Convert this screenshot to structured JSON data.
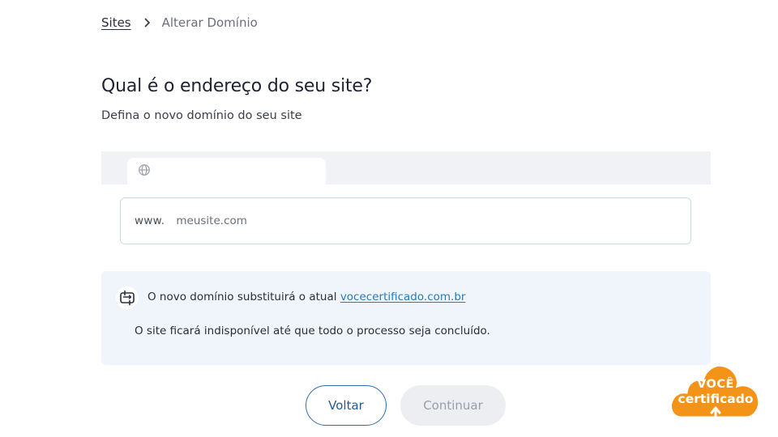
{
  "breadcrumb": {
    "parent": "Sites",
    "current": "Alterar Domínio",
    "separator_icon": "chevron-right-icon"
  },
  "header": {
    "title": "Qual é o endereço do seu site?",
    "subtitle": "Defina o novo domínio do seu site"
  },
  "tab": {
    "icon": "globe-icon",
    "label": ""
  },
  "domain_field": {
    "prefix": "www.",
    "placeholder": "meusite.com",
    "value": ""
  },
  "notice": {
    "icon": "swap-icon",
    "text_prefix": "O novo domínio substituirá o atual ",
    "current_domain": "vocecertificado.com.br",
    "warning": "O site ficará indisponível até que todo o processo seja concluído."
  },
  "actions": {
    "back_label": "Voltar",
    "continue_label": "Continuar",
    "continue_disabled": true
  },
  "badge": {
    "line1": "VOCÊ",
    "line2": "certificado",
    "icon": "upload-arrow-icon"
  },
  "colors": {
    "primary": "#2b6db0",
    "link": "#2b7ab8",
    "notice_bg": "#eff5fb",
    "strip_bg": "#f0f2f6",
    "badge_orange": "#f39317",
    "disabled_bg": "#eceef2"
  }
}
